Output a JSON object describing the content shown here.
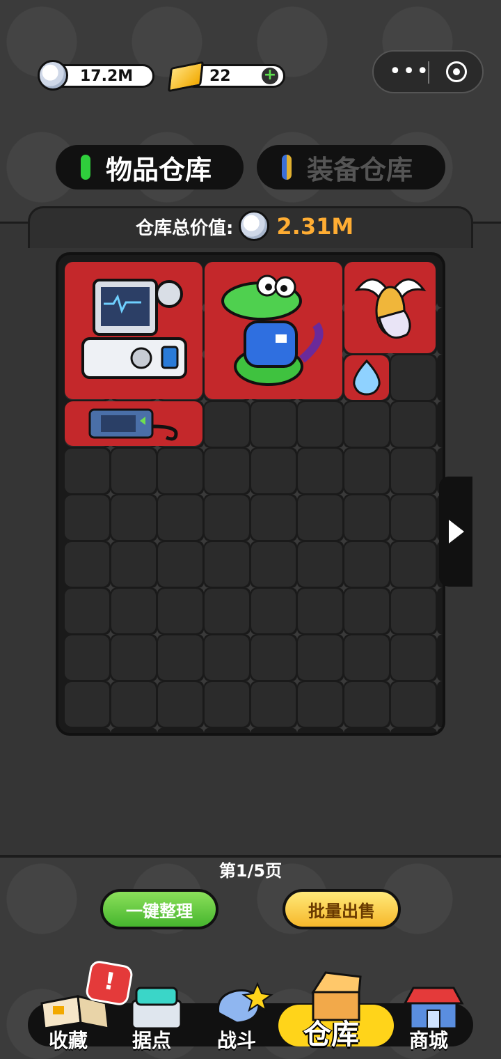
{
  "currency": {
    "silver": "17.2M",
    "gold": "22",
    "add_symbol": "+"
  },
  "capsule": {
    "menu": "•••"
  },
  "tabs": [
    {
      "label": "物品仓库",
      "color": "#2fcf3c",
      "active": true
    },
    {
      "label": "装备仓库",
      "color": "#3a6fd8",
      "active": false
    }
  ],
  "warehouse": {
    "value_label": "仓库总价值:",
    "value": "2.31M"
  },
  "items": [
    {
      "name": "monitor-device"
    },
    {
      "name": "crocodile-figure"
    },
    {
      "name": "winged-ghost-charm"
    },
    {
      "name": "blue-crystal-drop"
    },
    {
      "name": "scanner-gadget"
    }
  ],
  "pagination": {
    "label": "第1/5页"
  },
  "actions": {
    "sort_label": "一键整理",
    "bulk_sell_label": "批量出售"
  },
  "nav": [
    {
      "label": "收藏",
      "badge": "!"
    },
    {
      "label": "据点"
    },
    {
      "label": "战斗"
    },
    {
      "label": "仓库",
      "active": true
    },
    {
      "label": "商城"
    }
  ],
  "colors": {
    "item_bg": "#c4282b",
    "accent_gold": "#ffad33",
    "nav_active": "#ffd41a"
  }
}
